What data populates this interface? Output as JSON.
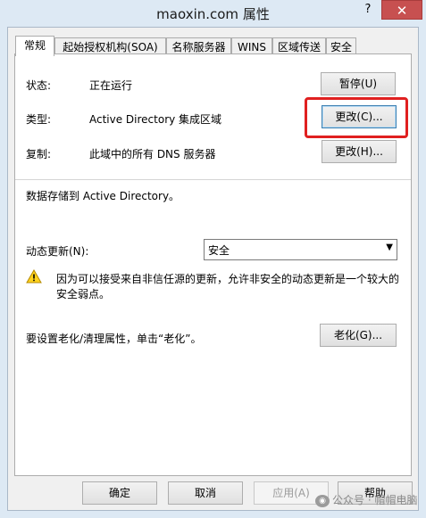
{
  "window": {
    "title": "maoxin.com 属性",
    "help_label": "?",
    "close_label": "✕"
  },
  "tabs": [
    {
      "label": "常规",
      "active": true
    },
    {
      "label": "起始授权机构(SOA)"
    },
    {
      "label": "名称服务器"
    },
    {
      "label": "WINS"
    },
    {
      "label": "区域传送"
    },
    {
      "label": "安全"
    }
  ],
  "general": {
    "status_label": "状态:",
    "status_value": "正在运行",
    "pause_button": "暂停(U)",
    "type_label": "类型:",
    "type_value": "Active Directory 集成区域",
    "change_type_button": "更改(C)...",
    "replication_label": "复制:",
    "replication_value": "此域中的所有 DNS 服务器",
    "change_replication_button": "更改(H)...",
    "storage_text": "数据存储到 Active Directory。",
    "dynamic_update_label": "动态更新(N):",
    "dynamic_update_value": "安全",
    "warning_text_line1": "因为可以接受来自非信任源的更新，允许非安全的动态更新是一个较大的",
    "warning_text_line2": "安全弱点。",
    "aging_text": "要设置老化/清理属性，单击“老化”。",
    "aging_button": "老化(G)..."
  },
  "footer": {
    "ok_button": "确定",
    "cancel_button": "取消",
    "apply_button": "应用(A)",
    "help_button": "帮助"
  },
  "watermark": {
    "text": "公众号 · 帽帽电脑"
  },
  "colors": {
    "highlight": "#e02020",
    "close": "#c75050",
    "frame": "#dde9f4"
  }
}
